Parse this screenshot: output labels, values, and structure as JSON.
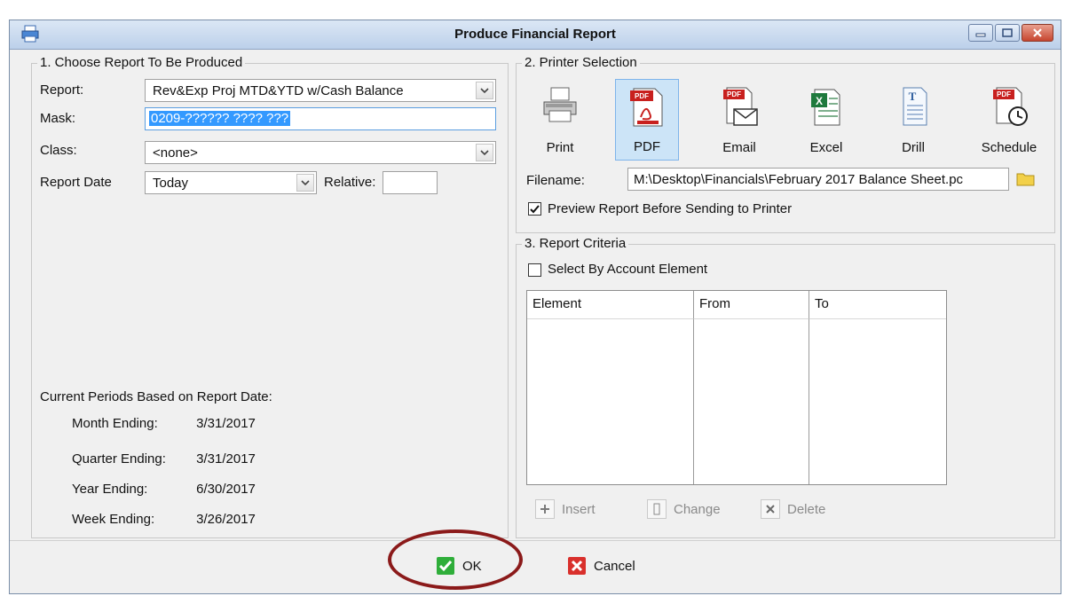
{
  "window": {
    "title": "Produce Financial Report"
  },
  "section1": {
    "legend": "1. Choose Report To Be Produced",
    "report_label": "Report:",
    "report_value": "Rev&Exp Proj MTD&YTD w/Cash Balance",
    "mask_label": "Mask:",
    "mask_value": "0209-?????? ???? ???",
    "class_label": "Class:",
    "class_value": "<none>",
    "report_date_label": "Report Date",
    "report_date_value": "Today",
    "relative_label": "Relative:",
    "relative_value": "",
    "periods_heading": "Current Periods Based on Report Date:",
    "periods": [
      {
        "label": "Month Ending:",
        "value": "3/31/2017"
      },
      {
        "label": "Quarter Ending:",
        "value": "3/31/2017"
      },
      {
        "label": "Year Ending:",
        "value": "6/30/2017"
      },
      {
        "label": "Week Ending:",
        "value": "3/26/2017"
      }
    ]
  },
  "section2": {
    "legend": "2. Printer Selection",
    "buttons": [
      {
        "label": "Print",
        "icon": "printer-icon"
      },
      {
        "label": "PDF",
        "icon": "pdf-icon",
        "selected": true
      },
      {
        "label": "Email",
        "icon": "email-pdf-icon"
      },
      {
        "label": "Excel",
        "icon": "excel-icon"
      },
      {
        "label": "Drill",
        "icon": "drill-icon"
      },
      {
        "label": "Schedule",
        "icon": "schedule-pdf-icon"
      }
    ],
    "filename_label": "Filename:",
    "filename_value": "M:\\Desktop\\Financials\\February 2017 Balance Sheet.pc",
    "preview_label": "Preview Report Before Sending to Printer",
    "preview_checked": true
  },
  "section3": {
    "legend": "3. Report Criteria",
    "select_by_label": "Select By Account Element",
    "select_by_checked": false,
    "columns": [
      "Element",
      "From",
      "To"
    ],
    "insert_label": "Insert",
    "change_label": "Change",
    "delete_label": "Delete"
  },
  "footer": {
    "ok_label": "OK",
    "cancel_label": "Cancel"
  },
  "colors": {
    "ok_green": "#2fae3a",
    "cancel_red": "#d9302c",
    "highlight_circle": "#8b1a1a",
    "selection_blue": "#3399ff",
    "pdf_red": "#c8201e"
  }
}
